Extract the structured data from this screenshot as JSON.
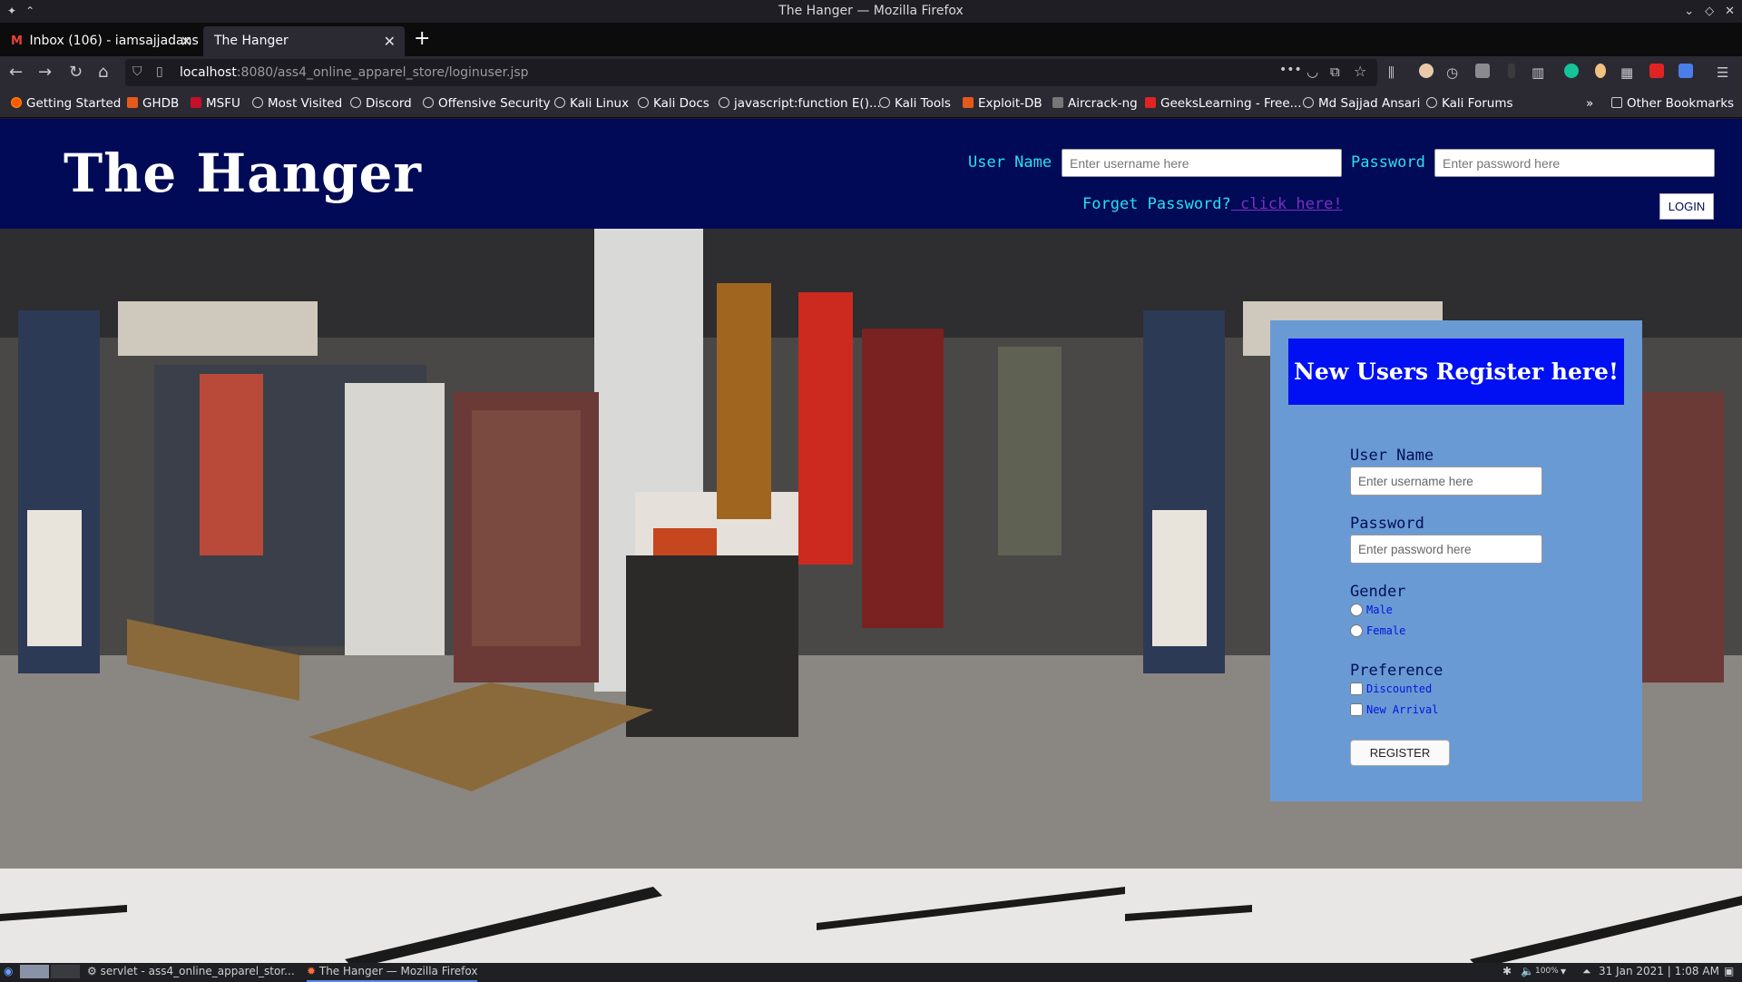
{
  "window": {
    "title": "The Hanger — Mozilla Firefox"
  },
  "tabs": [
    {
      "label": "Inbox (106) - iamsajjadans"
    },
    {
      "label": "The Hanger"
    }
  ],
  "nav": {
    "url_host": "localhost",
    "url_path": ":8080/ass4_online_apparel_store/loginuser.jsp"
  },
  "bookmarks": [
    "Getting Started",
    "GHDB",
    "MSFU",
    "Most Visited",
    "Discord",
    "Offensive Security",
    "Kali Linux",
    "Kali Docs",
    "javascript:function E()...",
    "Kali Tools",
    "Exploit-DB",
    "Aircrack-ng",
    "GeeksLearning - Free...",
    "Md Sajjad Ansari",
    "Kali Forums"
  ],
  "bookmarks_other": "Other Bookmarks",
  "header": {
    "logo": "The Hanger",
    "username_label": "User Name",
    "username_placeholder": "Enter username here",
    "password_label": "Password",
    "password_placeholder": "Enter password here",
    "forgot_text": "Forget Password?",
    "forgot_link": " click here! ",
    "login_button": "LOGIN"
  },
  "register": {
    "title": "New Users Register here!",
    "username_label": "User Name",
    "username_placeholder": "Enter username here",
    "password_label": "Password",
    "password_placeholder": "Enter password here",
    "gender_label": "Gender",
    "gender_options": [
      "Male",
      "Female"
    ],
    "preference_label": "Preference",
    "preference_options": [
      "Discounted",
      "New Arrival"
    ],
    "button": "REGISTER"
  },
  "taskbar": {
    "task1": "servlet - ass4_online_apparel_stor...",
    "task2": "The Hanger — Mozilla Firefox",
    "volume": "100%",
    "datetime": "31 Jan 2021 | 1:08 AM"
  },
  "colors": {
    "header_bg": "#000a57",
    "accent_cyan": "#27e0f0",
    "panel_bg": "#6a9ad3",
    "panel_head": "#0010f2"
  }
}
